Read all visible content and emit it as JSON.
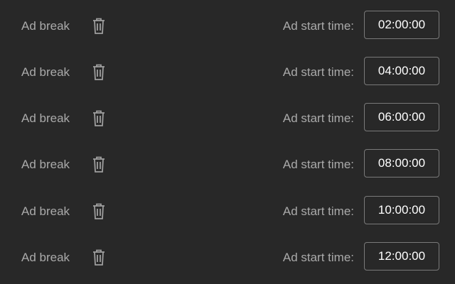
{
  "colors": {
    "background": "#282828",
    "label_text": "#aaaaaa",
    "value_text": "#ffffff",
    "input_border": "#7a7a7a",
    "icon": "#9e9e9e"
  },
  "ad_breaks": [
    {
      "label": "Ad break",
      "start_label": "Ad start time:",
      "start_time": "02:00:00",
      "delete_icon": "trash-icon"
    },
    {
      "label": "Ad break",
      "start_label": "Ad start time:",
      "start_time": "04:00:00",
      "delete_icon": "trash-icon"
    },
    {
      "label": "Ad break",
      "start_label": "Ad start time:",
      "start_time": "06:00:00",
      "delete_icon": "trash-icon"
    },
    {
      "label": "Ad break",
      "start_label": "Ad start time:",
      "start_time": "08:00:00",
      "delete_icon": "trash-icon"
    },
    {
      "label": "Ad break",
      "start_label": "Ad start time:",
      "start_time": "10:00:00",
      "delete_icon": "trash-icon"
    },
    {
      "label": "Ad break",
      "start_label": "Ad start time:",
      "start_time": "12:00:00",
      "delete_icon": "trash-icon"
    }
  ]
}
